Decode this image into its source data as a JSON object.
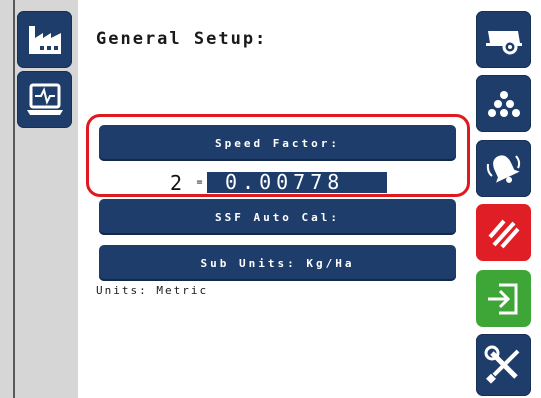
{
  "header": {
    "title": "General Setup:"
  },
  "left_nav": [
    {
      "icon": "factory-icon"
    },
    {
      "icon": "monitor-diagnostics-icon"
    }
  ],
  "right_nav": [
    {
      "icon": "spreader-trailer-icon"
    },
    {
      "icon": "granules-icon"
    },
    {
      "icon": "alarm-bell-icon"
    },
    {
      "icon": "hazard-stripes-icon",
      "color": "#e01e26"
    },
    {
      "icon": "exit-arrow-icon",
      "color": "#3ea637"
    },
    {
      "icon": "tools-wrench-screwdriver-icon"
    }
  ],
  "speed_factor": {
    "label": "Speed Factor:",
    "prefix": "2",
    "equals": "=",
    "value": "0.00778"
  },
  "ssf_auto_cal": {
    "label": "SSF Auto Cal:"
  },
  "sub_units": {
    "label": "Sub Units: Kg/Ha"
  },
  "units": {
    "text": "Units: Metric"
  },
  "colors": {
    "button_navy": "#1f3d6b",
    "highlight_red": "#e0191e",
    "rail_gray": "#d6d6d6"
  }
}
